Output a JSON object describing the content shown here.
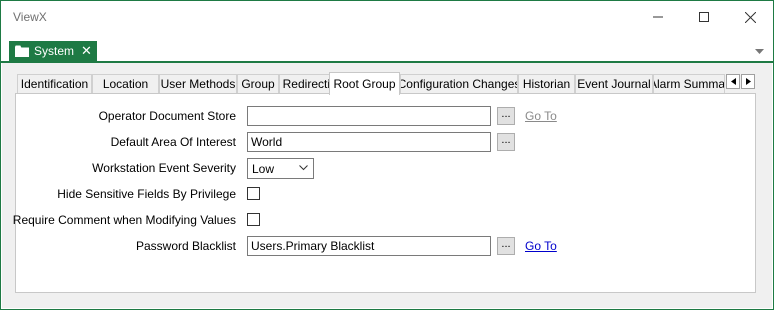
{
  "window": {
    "title": "ViewX"
  },
  "doc_tab": {
    "label": "System",
    "close_glyph": "✕",
    "icon": "folder-icon"
  },
  "tabs": [
    {
      "label": "Identification",
      "active": false
    },
    {
      "label": "Location",
      "active": false
    },
    {
      "label": "User Methods",
      "active": false
    },
    {
      "label": "Group",
      "active": false
    },
    {
      "label": "Redirection",
      "active": false
    },
    {
      "label": "Root Group",
      "active": true
    },
    {
      "label": "Configuration Changes",
      "active": false
    },
    {
      "label": "Historian",
      "active": false
    },
    {
      "label": "Event Journal",
      "active": false
    },
    {
      "label": "Alarm Summar",
      "active": false
    }
  ],
  "form": {
    "operator_document_store": {
      "label": "Operator Document Store",
      "value": "",
      "browse": "...",
      "link": "Go To",
      "link_enabled": false
    },
    "default_area_of_interest": {
      "label": "Default Area Of Interest",
      "value": "World",
      "browse": "..."
    },
    "workstation_event_severity": {
      "label": "Workstation Event Severity",
      "value": "Low"
    },
    "hide_sensitive_fields": {
      "label": "Hide Sensitive Fields By Privilege",
      "checked": false
    },
    "require_comment": {
      "label": "Require Comment when Modifying Values",
      "checked": false
    },
    "password_blacklist": {
      "label": "Password Blacklist",
      "value": "Users.Primary Blacklist",
      "browse": "...",
      "link": "Go To",
      "link_enabled": true
    }
  },
  "colors": {
    "accent": "#1e7a44",
    "link": "#0000cc",
    "link_disabled": "#8a8a8a",
    "panel": "#f0f0f0"
  }
}
